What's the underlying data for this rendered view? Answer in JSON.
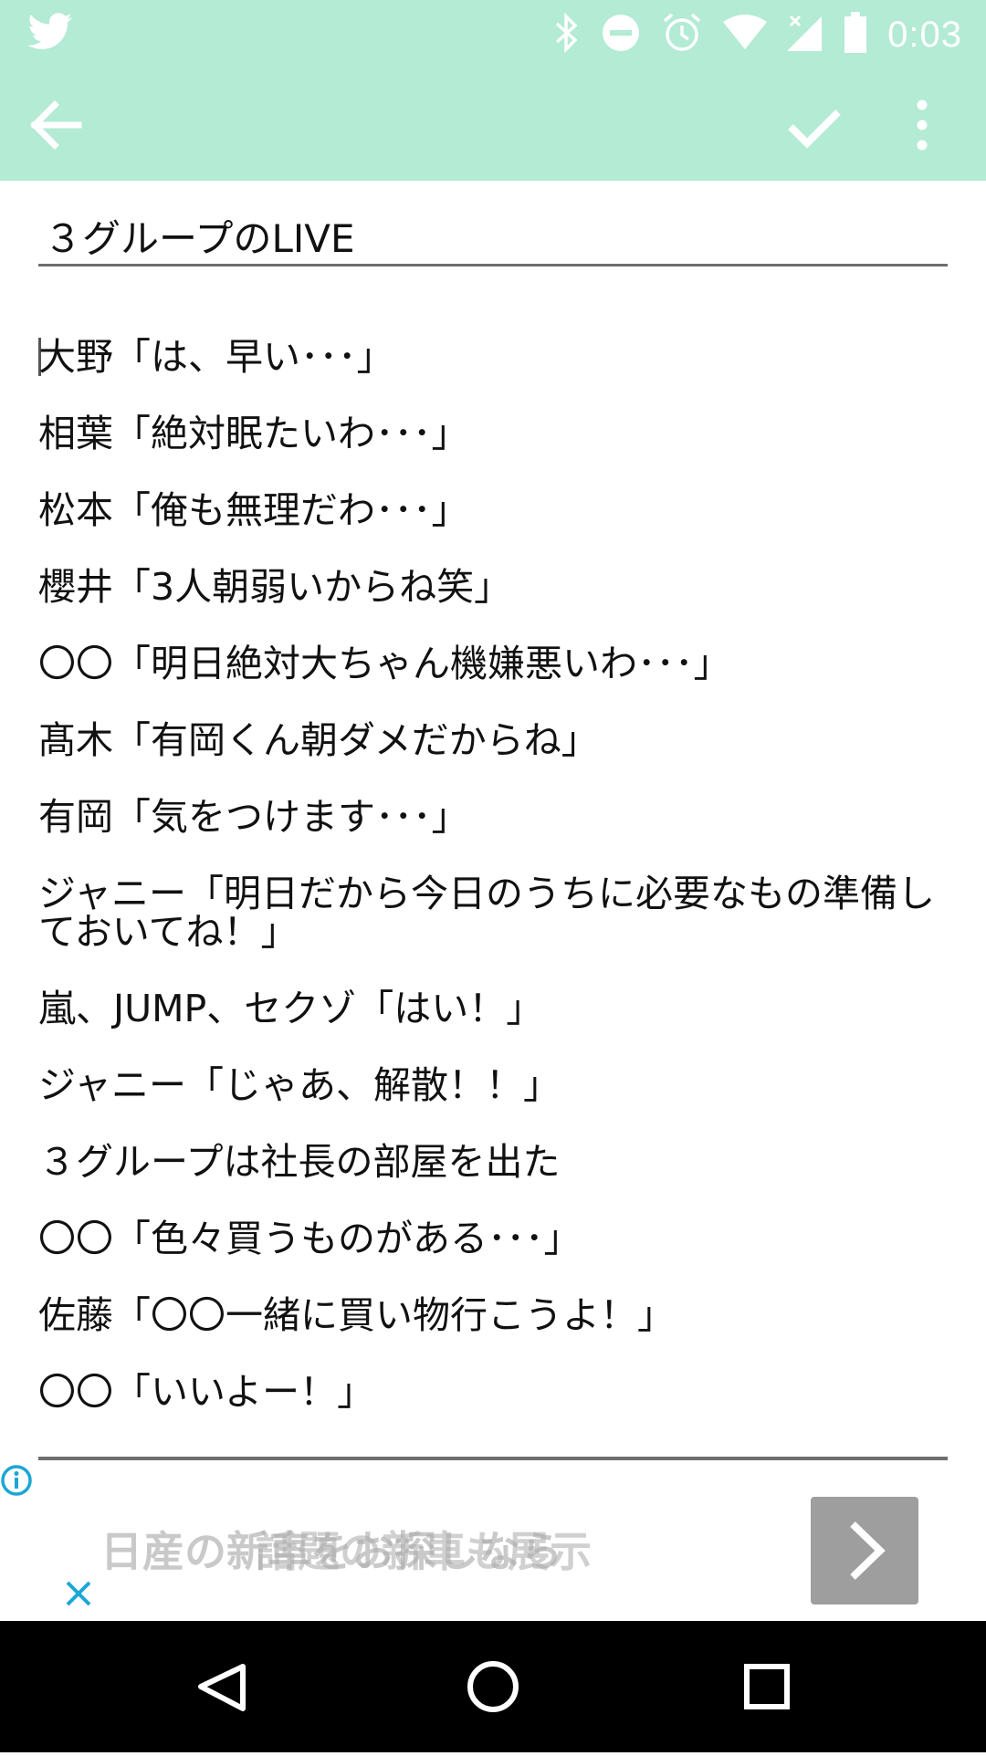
{
  "status_bar": {
    "time": "0:03",
    "icons": [
      "twitter-icon",
      "bluetooth-icon",
      "dnd-icon",
      "alarm-icon",
      "wifi-icon",
      "signal-icon",
      "battery-icon"
    ]
  },
  "toolbar": {
    "back_icon": "arrow-left-icon",
    "confirm_icon": "check-icon",
    "more_icon": "more-vert-icon"
  },
  "editor": {
    "title": "３グループのLIVE",
    "lines": [
      "大野「は、早い･･･」",
      "相葉「絶対眠たいわ･･･」",
      "松本「俺も無理だわ･･･」",
      "櫻井「3人朝弱いからね笑」",
      "〇〇「明日絶対大ちゃん機嫌悪いわ･･･」",
      "髙木「有岡くん朝ダメだからね」",
      "有岡「気をつけます･･･」",
      "ジャニー「明日だから今日のうちに必要なもの準備しておいてね！」",
      "嵐、JUMP、セクゾ「はい！」",
      "ジャニー「じゃあ、解散！！」",
      "３グループは社長の部屋を出た",
      "〇〇「色々買うものがある･･･」",
      "佐藤「〇〇一緒に買い物行こうよ！」",
      "〇〇「いいよー！」"
    ]
  },
  "ad": {
    "text": "日産の新車をお探しなら",
    "ghost_text": "話題の新車も展示"
  },
  "nav_bar": {
    "icons": [
      "back-triangle-icon",
      "home-circle-icon",
      "recents-square-icon"
    ]
  },
  "colors": {
    "accent": "#b3ebd5",
    "nav_bg": "#000000"
  }
}
